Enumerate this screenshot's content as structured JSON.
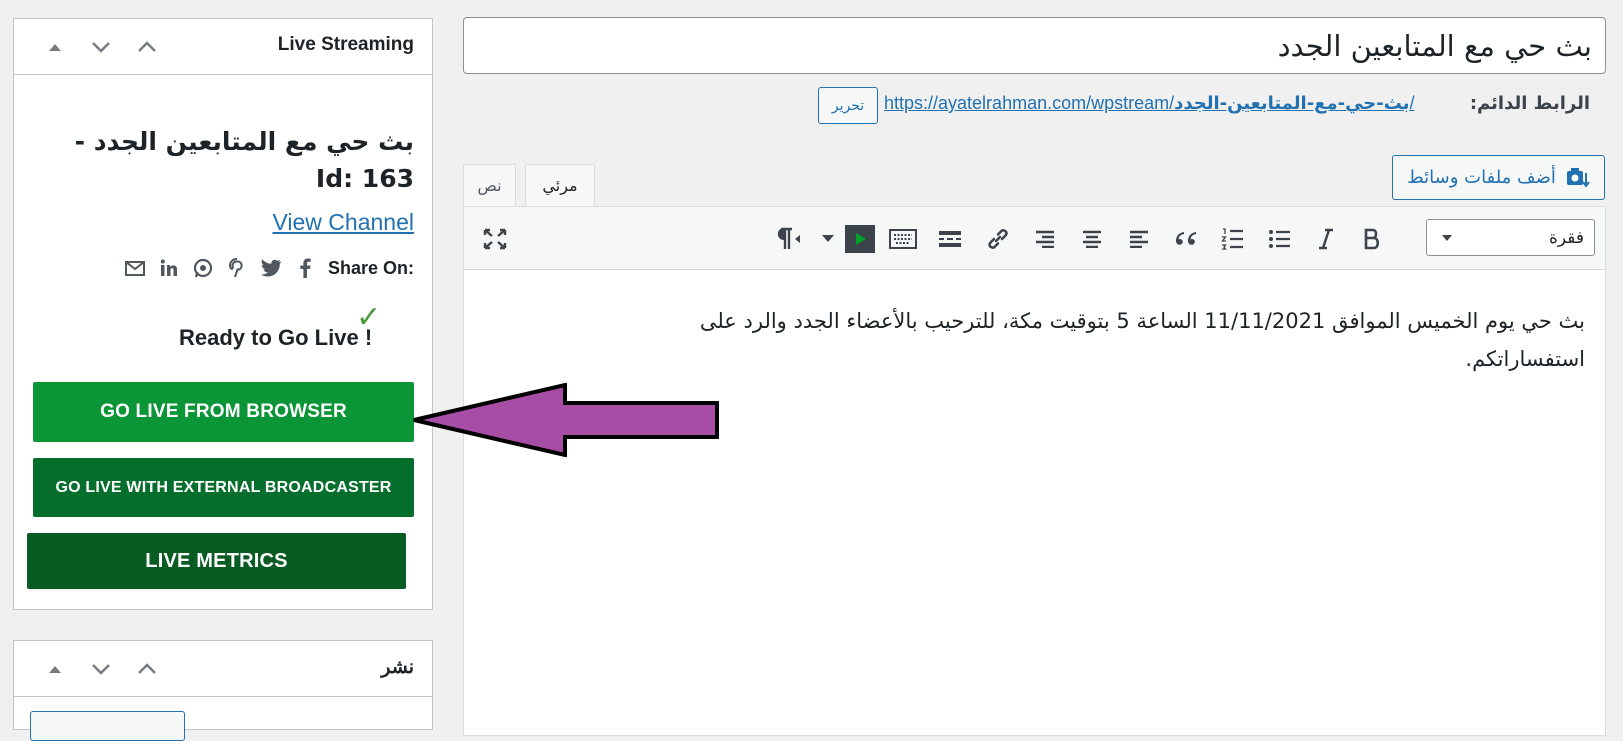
{
  "live_streaming": {
    "title": "Live Streaming",
    "stream_title": "بث حي مع المتابعين الجدد - Id: 163",
    "view_channel": "View Channel",
    "share_label": "Share On:",
    "share_icons": [
      "facebook-icon",
      "twitter-icon",
      "pinterest-icon",
      "whatsapp-icon",
      "linkedin-icon",
      "email-icon"
    ],
    "ready_text": "Ready to Go Live !",
    "buttons": {
      "browser": "GO LIVE FROM BROWSER",
      "external": "GO LIVE WITH EXTERNAL BROADCASTER",
      "metrics": "LIVE METRICS"
    },
    "colors": {
      "browser": "#0a9536",
      "external": "#066e2c",
      "metrics": "#095b24",
      "arrow": "#a64ea6"
    }
  },
  "publish_box": {
    "title": "نشر"
  },
  "post": {
    "title": "بث حي مع المتابعين الجدد",
    "permalink_label": "الرابط الدائم:",
    "permalink_base": "https://ayatelrahman.com/wpstream/",
    "permalink_slug": "بث-حي-مع-المتابعين-الجدد",
    "permalink_end": "/",
    "edit_label": "تحرير",
    "add_media": "أضف ملفات وسائط",
    "tabs": {
      "visual": "مرئي",
      "text": "نص"
    },
    "format": "فقرة",
    "content": "بث حي يوم الخميس الموافق 11/11/2021 الساعة 5 بتوقيت مكة، للترحيب بالأعضاء الجدد والرد على استفساراتكم."
  }
}
